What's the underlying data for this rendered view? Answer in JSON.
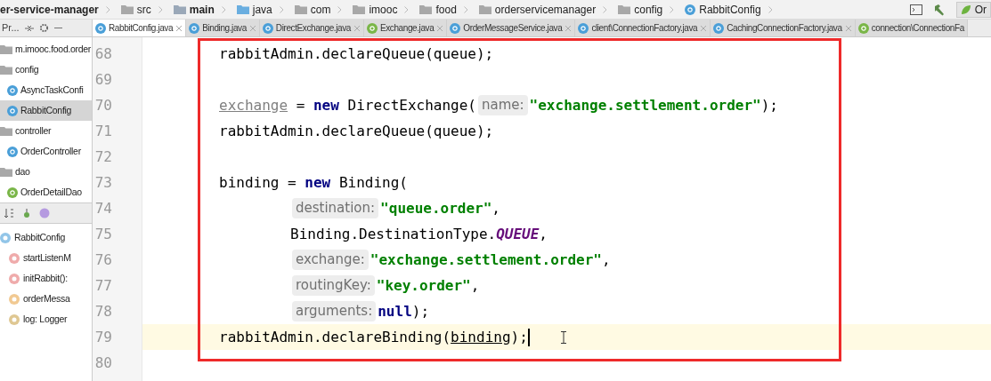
{
  "breadcrumb": [
    {
      "label": "er-service-manager",
      "kind": "module"
    },
    {
      "label": "src",
      "kind": "folder"
    },
    {
      "label": "main",
      "kind": "source"
    },
    {
      "label": "java",
      "kind": "sources"
    },
    {
      "label": "com",
      "kind": "folder"
    },
    {
      "label": "imooc",
      "kind": "folder"
    },
    {
      "label": "food",
      "kind": "folder"
    },
    {
      "label": "orderservicemanager",
      "kind": "folder"
    },
    {
      "label": "config",
      "kind": "folder"
    },
    {
      "label": "RabbitConfig",
      "kind": "class"
    }
  ],
  "run_config": {
    "label": "Or"
  },
  "tool_window_tab": {
    "label": "Pr..."
  },
  "tabs": [
    {
      "label": "RabbitConfig.java",
      "kind": "class",
      "selected": true
    },
    {
      "label": "Binding.java",
      "kind": "class",
      "selected": false
    },
    {
      "label": "DirectExchange.java",
      "kind": "class",
      "selected": false
    },
    {
      "label": "Exchange.java",
      "kind": "interface",
      "selected": false
    },
    {
      "label": "OrderMessageService.java",
      "kind": "class",
      "selected": false
    },
    {
      "label": "client\\ConnectionFactory.java",
      "kind": "class",
      "selected": false
    },
    {
      "label": "CachingConnectionFactory.java",
      "kind": "class",
      "selected": false
    },
    {
      "label": "connection\\ConnectionFa",
      "kind": "interface",
      "selected": false
    }
  ],
  "project_tree": [
    {
      "label": "m.imooc.food.order",
      "kind": "package",
      "selected": false
    },
    {
      "label": "config",
      "kind": "package",
      "selected": false,
      "children": [
        {
          "label": "AsyncTaskConfi",
          "kind": "class",
          "selected": false
        },
        {
          "label": "RabbitConfig",
          "kind": "class",
          "selected": true
        }
      ]
    },
    {
      "label": "controller",
      "kind": "package",
      "selected": false,
      "children": [
        {
          "label": "OrderController",
          "kind": "class",
          "selected": false
        }
      ]
    },
    {
      "label": "dao",
      "kind": "package",
      "selected": false,
      "children": [
        {
          "label": "OrderDetailDao",
          "kind": "interface",
          "selected": false
        }
      ]
    }
  ],
  "structure": {
    "items": [
      {
        "label": "RabbitConfig",
        "kind": "class",
        "children": [
          {
            "label": "startListenM",
            "kind": "method"
          },
          {
            "label": "initRabbit(): ",
            "kind": "method"
          },
          {
            "label": "orderMessa",
            "kind": "field"
          },
          {
            "label": "log: Logger",
            "kind": "static-field"
          }
        ]
      }
    ]
  },
  "code_lines": [
    {
      "number": "68",
      "current": false,
      "indented": false,
      "tokens": [
        {
          "text": "rabbitAdmin.declareQueue(queue);",
          "kind": "plain"
        }
      ]
    },
    {
      "number": "69",
      "current": false
    },
    {
      "number": "70",
      "current": false,
      "indented": false,
      "tokens": [
        {
          "text": "exchange",
          "kind": "unused"
        },
        {
          "text": " = ",
          "kind": "plain"
        },
        {
          "text": "new",
          "kind": "keyword"
        },
        {
          "text": " DirectExchange(",
          "kind": "plain"
        },
        {
          "text": "name:",
          "kind": "hint"
        },
        {
          "text": "\"exchange.settlement.order\"",
          "kind": "string"
        },
        {
          "text": ");",
          "kind": "plain"
        }
      ]
    },
    {
      "number": "71",
      "current": false,
      "indented": false,
      "tokens": [
        {
          "text": "rabbitAdmin.declareQueue(queue);",
          "kind": "plain"
        }
      ]
    },
    {
      "number": "72",
      "current": false
    },
    {
      "number": "73",
      "current": false,
      "indented": false,
      "tokens": [
        {
          "text": "binding",
          "kind": "plain"
        },
        {
          "text": " = ",
          "kind": "plain"
        },
        {
          "text": "new",
          "kind": "keyword"
        },
        {
          "text": " Binding(",
          "kind": "plain"
        }
      ]
    },
    {
      "number": "74",
      "current": false,
      "indented": true,
      "tokens": [
        {
          "text": "destination:",
          "kind": "hint"
        },
        {
          "text": "\"queue.order\"",
          "kind": "string"
        },
        {
          "text": ",",
          "kind": "plain"
        }
      ]
    },
    {
      "number": "75",
      "current": false,
      "indented": true,
      "tokens": [
        {
          "text": "Binding.DestinationType.",
          "kind": "plain"
        },
        {
          "text": "QUEUE",
          "kind": "constant"
        },
        {
          "text": ",",
          "kind": "plain"
        }
      ]
    },
    {
      "number": "76",
      "current": false,
      "indented": true,
      "tokens": [
        {
          "text": "exchange:",
          "kind": "hint"
        },
        {
          "text": "\"exchange.settlement.order\"",
          "kind": "string"
        },
        {
          "text": ",",
          "kind": "plain"
        }
      ]
    },
    {
      "number": "77",
      "current": false,
      "indented": true,
      "tokens": [
        {
          "text": "routingKey:",
          "kind": "hint"
        },
        {
          "text": "\"key.order\"",
          "kind": "string"
        },
        {
          "text": ",",
          "kind": "plain"
        }
      ]
    },
    {
      "number": "78",
      "current": false,
      "indented": true,
      "tokens": [
        {
          "text": "arguments:",
          "kind": "hint"
        },
        {
          "text": "null",
          "kind": "keyword"
        },
        {
          "text": ");",
          "kind": "plain"
        }
      ]
    },
    {
      "number": "79",
      "current": true,
      "indented": false,
      "tokens": [
        {
          "text": "rabbitAdmin.declareBinding(",
          "kind": "plain"
        },
        {
          "text": "binding",
          "kind": "underlined"
        },
        {
          "text": ");",
          "kind": "plain"
        }
      ]
    },
    {
      "number": "80",
      "current": false
    }
  ]
}
